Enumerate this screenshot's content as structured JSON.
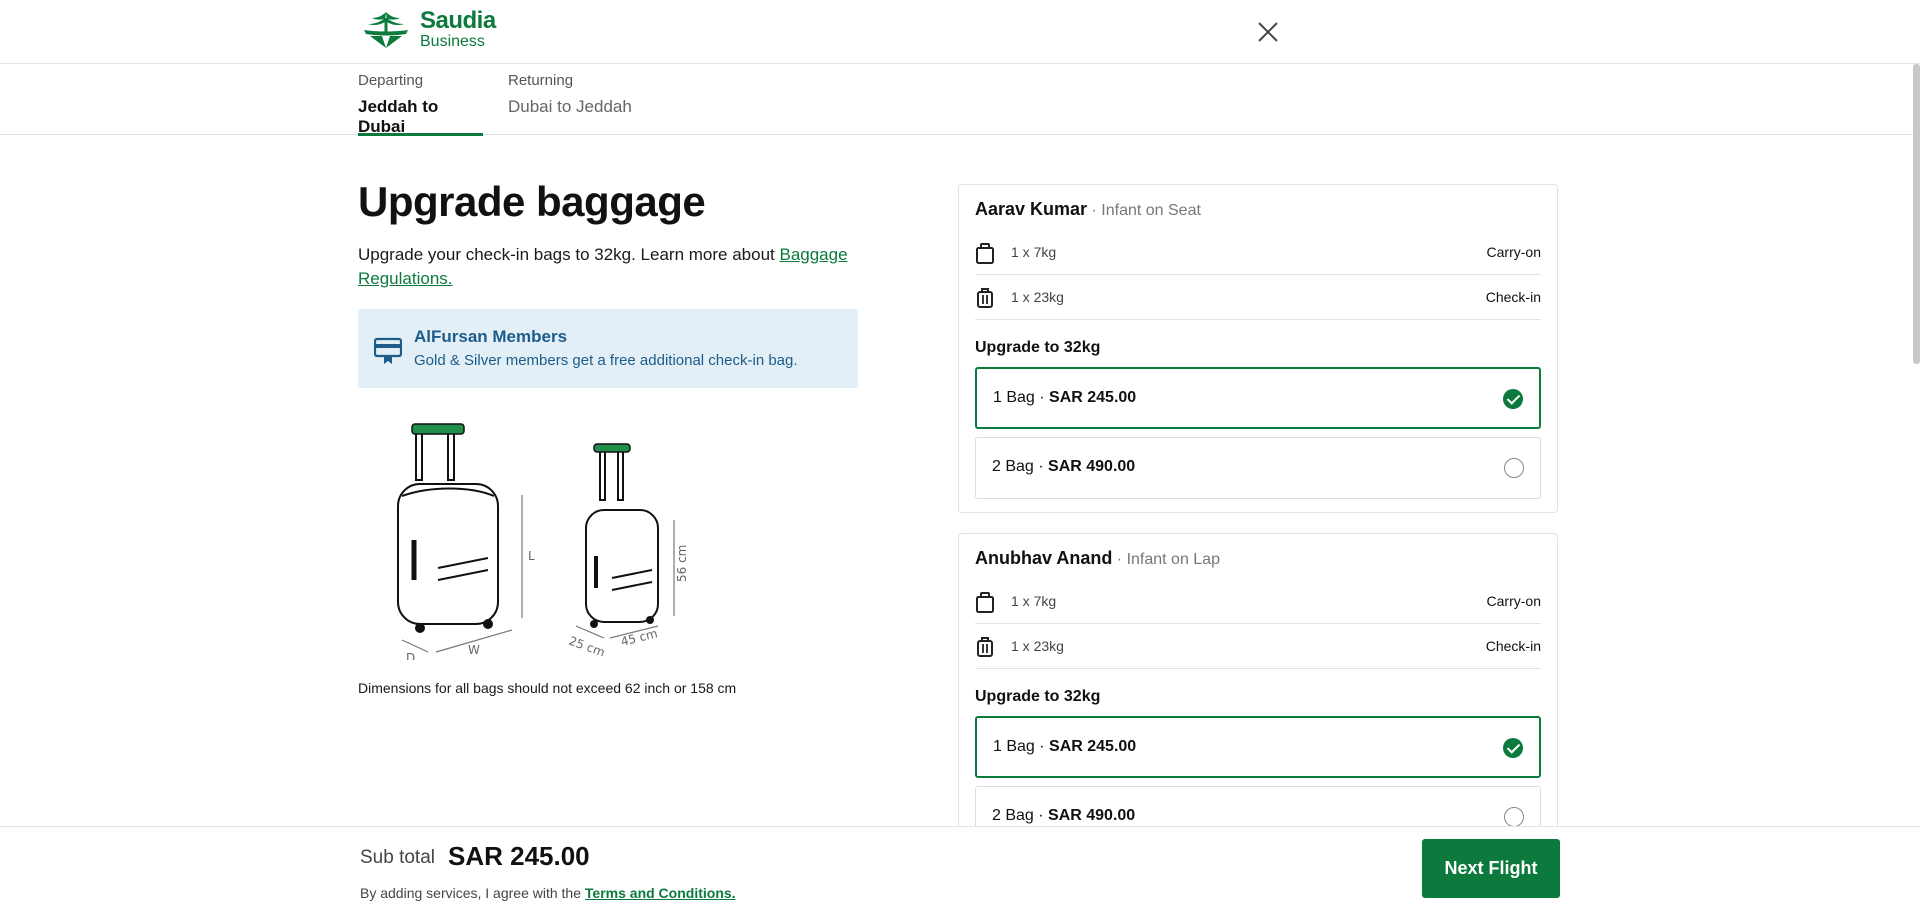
{
  "header": {
    "logo_line1": "Saudia",
    "logo_line2": "Business",
    "brand_color": "#0c7a3d"
  },
  "tabs": [
    {
      "small": "Departing",
      "main": "Jeddah to Dubai",
      "active": true
    },
    {
      "small": "Returning",
      "main": "Dubai to Jeddah",
      "active": false
    }
  ],
  "main": {
    "title": "Upgrade baggage",
    "intro_text": "Upgrade your check-in bags to 32kg. Learn more about ",
    "intro_link": "Baggage Regulations.",
    "alfursan_title": "AlFursan Members",
    "alfursan_sub": "Gold & Silver members get a free additional check-in bag.",
    "dims_note": "Dimensions for all bags should not exceed 62 inch or 158 cm",
    "luggage_labels": {
      "l": "L",
      "d": "D",
      "w": "W",
      "h56": "56 cm",
      "d25": "25 cm",
      "w45": "45 cm"
    }
  },
  "passengers": [
    {
      "name": "Aarav Kumar",
      "type": " · Infant on Seat",
      "bags": [
        {
          "icon": "carry-on-bag-icon",
          "text": "1 x 7kg",
          "type": "Carry-on"
        },
        {
          "icon": "check-in-bag-icon",
          "text": "1 x 23kg",
          "type": "Check-in"
        }
      ],
      "upgrade_title": "Upgrade to 32kg",
      "options": [
        {
          "qty": "1 Bag · ",
          "price": "SAR 245.00",
          "selected": true
        },
        {
          "qty": "2 Bag · ",
          "price": "SAR 490.00",
          "selected": false
        }
      ]
    },
    {
      "name": "Anubhav Anand",
      "type": " · Infant on Lap",
      "bags": [
        {
          "icon": "carry-on-bag-icon",
          "text": "1 x 7kg",
          "type": "Carry-on"
        },
        {
          "icon": "check-in-bag-icon",
          "text": "1 x 23kg",
          "type": "Check-in"
        }
      ],
      "upgrade_title": "Upgrade to 32kg",
      "options": [
        {
          "qty": "1 Bag · ",
          "price": "SAR 245.00",
          "selected": true
        },
        {
          "qty": "2 Bag · ",
          "price": "SAR 490.00",
          "selected": false
        }
      ]
    }
  ],
  "footer": {
    "subtotal_label": "Sub total",
    "subtotal_value": "SAR 245.00",
    "agree_text": "By adding services, I agree with the ",
    "agree_link": "Terms and Conditions.",
    "next_button": "Next Flight"
  }
}
